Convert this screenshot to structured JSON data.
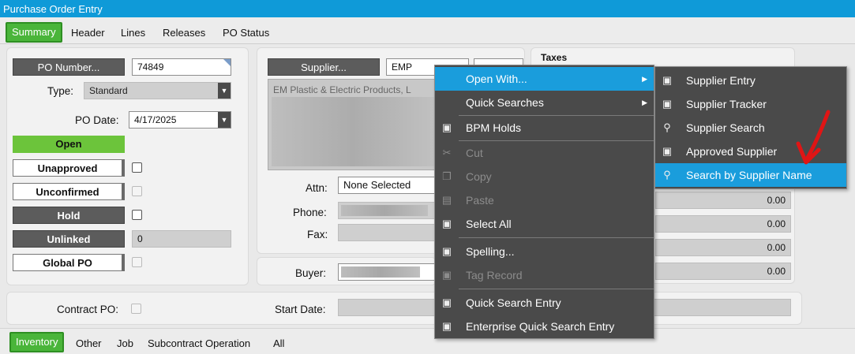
{
  "window": {
    "title": "Purchase Order Entry"
  },
  "tabs": {
    "summary": "Summary",
    "header": "Header",
    "lines": "Lines",
    "releases": "Releases",
    "po_status": "PO Status"
  },
  "left": {
    "po_number_label": "PO Number...",
    "po_number_value": "74849",
    "type_label": "Type:",
    "type_value": "Standard",
    "po_date_label": "PO Date:",
    "po_date_value": "4/17/2025",
    "status_open": "Open",
    "unapproved": "Unapproved",
    "unconfirmed": "Unconfirmed",
    "hold": "Hold",
    "unlinked": "Unlinked",
    "unlinked_value": "0",
    "global_po": "Global PO"
  },
  "supplier": {
    "button": "Supplier...",
    "id_value": "EMP",
    "address_line1": "EM Plastic & Electric Products, L",
    "attn_label": "Attn:",
    "attn_value": "None Selected",
    "phone_label": "Phone:",
    "fax_label": "Fax:",
    "buyer_label": "Buyer:"
  },
  "taxes": {
    "title": "Taxes",
    "values": [
      "0.00",
      "0.00",
      "0.00",
      "0.00"
    ]
  },
  "bottom_row": {
    "contract_po_label": "Contract PO:",
    "start_date_label": "Start Date:"
  },
  "bottom_tabs": {
    "inventory": "Inventory",
    "other": "Other",
    "job": "Job",
    "subcontract": "Subcontract Operation",
    "all": "All"
  },
  "context_menu": {
    "open_with": "Open With...",
    "quick_searches": "Quick Searches",
    "bpm_holds": "BPM Holds",
    "cut": "Cut",
    "copy": "Copy",
    "paste": "Paste",
    "select_all": "Select All",
    "spelling": "Spelling...",
    "tag_record": "Tag Record",
    "quick_search_entry": "Quick Search Entry",
    "enterprise_quick_search_entry": "Enterprise Quick Search Entry"
  },
  "submenu": {
    "supplier_entry": "Supplier Entry",
    "supplier_tracker": "Supplier Tracker",
    "supplier_search": "Supplier Search",
    "approved_supplier": "Approved Supplier",
    "search_by_supplier_name": "Search by Supplier Name"
  },
  "colors": {
    "title_bar": "#0f9ad8",
    "tab_active": "#4ab53a",
    "menu_bg": "#4a4a4a",
    "menu_highlight": "#1a9ddc",
    "annotation_arrow": "#e01515"
  }
}
